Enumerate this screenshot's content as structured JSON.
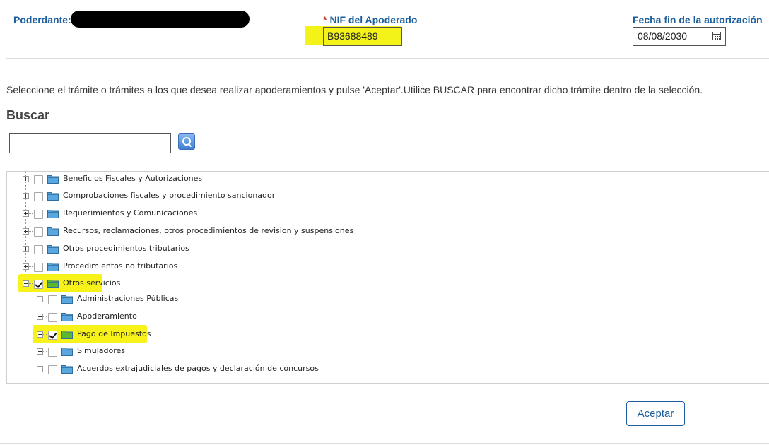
{
  "header": {
    "poderdante_label": "Poderdante:",
    "nif_required_mark": "*",
    "nif_label": "NIF del Apoderado",
    "nif_value": "B93688489",
    "fecha_label": "Fecha fin de la autorización",
    "fecha_value": "08/08/2030"
  },
  "instructions": "Seleccione el trámite o trámites a los que desea realizar apoderamientos y pulse 'Aceptar'.Utilice BUSCAR para encontrar dicho trámite dentro de la selección.",
  "search": {
    "title": "Buscar",
    "value": "",
    "button_icon": "search-icon"
  },
  "tree": {
    "nodes": [
      {
        "label": "Beneficios Fiscales y Autorizaciones",
        "checked": false,
        "expanded": false
      },
      {
        "label": "Comprobaciones fiscales y procedimiento sancionador",
        "checked": false,
        "expanded": false
      },
      {
        "label": "Requerimientos y Comunicaciones",
        "checked": false,
        "expanded": false
      },
      {
        "label": "Recursos, reclamaciones, otros procedimientos de revision y suspensiones",
        "checked": false,
        "expanded": false
      },
      {
        "label": "Otros procedimientos tributarios",
        "checked": false,
        "expanded": false
      },
      {
        "label": "Procedimientos no tributarios",
        "checked": false,
        "expanded": false
      },
      {
        "label": "Otros servicios",
        "checked": true,
        "expanded": true,
        "highlighted": true,
        "children": [
          {
            "label": "Administraciones Públicas",
            "checked": false,
            "expanded": false
          },
          {
            "label": "Apoderamiento",
            "checked": false,
            "expanded": false
          },
          {
            "label": "Pago de Impuestos",
            "checked": true,
            "expanded": false,
            "highlighted": true
          },
          {
            "label": "Simuladores",
            "checked": false,
            "expanded": false
          },
          {
            "label": "Acuerdos extrajudiciales de pagos y declaración de concursos",
            "checked": false,
            "expanded": false
          }
        ]
      }
    ]
  },
  "footer": {
    "accept_label": "Aceptar"
  },
  "colors": {
    "label_blue": "#1d5f9e",
    "highlight_yellow": "#f3f31a",
    "folder_blue": "#5aa7e0",
    "folder_green": "#5cb82e",
    "required_red": "#c0392b"
  }
}
